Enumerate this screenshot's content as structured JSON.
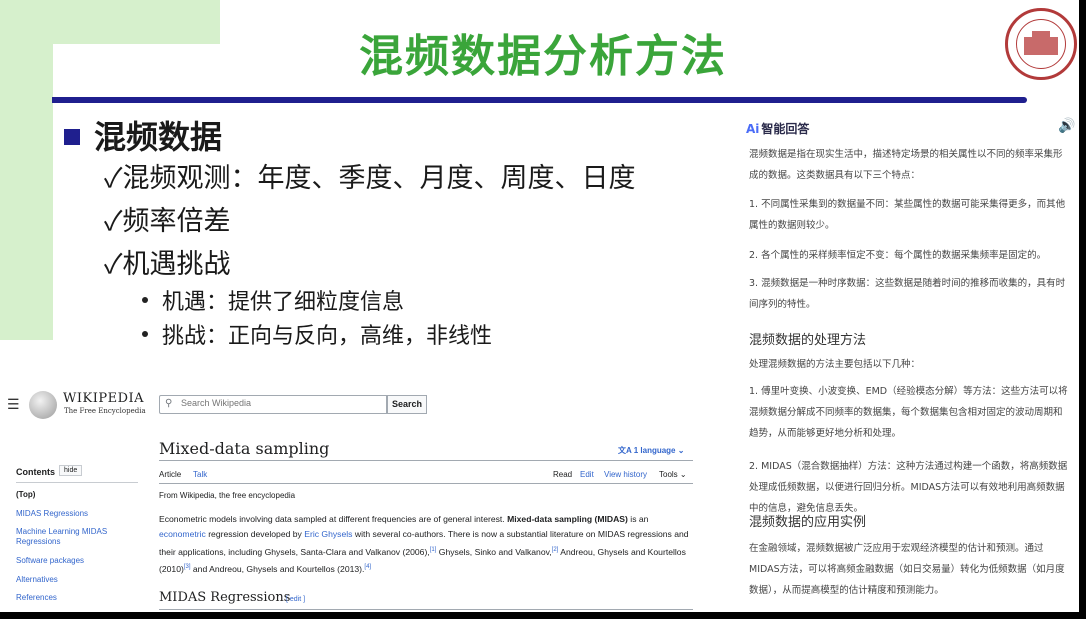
{
  "slide": {
    "title": "混频数据分析方法",
    "heading": "混频数据",
    "items": [
      "✓混频观测：年度、季度、月度、周度、日度",
      "✓频率倍差",
      "✓机遇挑战"
    ],
    "subitems": [
      "机遇：提供了细粒度信息",
      "挑战：正向与反向，高维，非线性"
    ]
  },
  "ai_panel": {
    "logo": "Ai",
    "title": "智能回答",
    "speaker_icon": "🔊",
    "p1": "混频数据是指在现实生活中，描述特定场景的相关属性以不同的频率采集形成的数据。这类数据具有以下三个特点：",
    "p2": "1. 不同属性采集到的数据量不同：某些属性的数据可能采集得更多，而其他属性的数据则较少。",
    "p3": "2. 各个属性的采样频率恒定不变：每个属性的数据采集频率是固定的。",
    "p4": "3. 混频数据是一种时序数据：这些数据是随着时间的推移而收集的，具有时间序列的特性。",
    "h1": "混频数据的处理方法",
    "p5": "处理混频数据的方法主要包括以下几种：",
    "p6": "1. 傅里叶变换、小波变换、EMD（经验模态分解）等方法：这些方法可以将混频数据分解成不同频率的数据集，每个数据集包含相对固定的波动周期和趋势，从而能够更好地分析和处理。",
    "p7": "2. MIDAS（混合数据抽样）方法：这种方法通过构建一个函数，将高频数据处理成低频数据，以便进行回归分析。MIDAS方法可以有效地利用高频数据中的信息，避免信息丢失。",
    "h2": "混频数据的应用实例",
    "p8": "在金融领域，混频数据被广泛应用于宏观经济模型的估计和预测。通过MIDAS方法，可以将高频金融数据（如日交易量）转化为低频数据（如月度数据），从而提高模型的估计精度和预测能力。"
  },
  "wiki": {
    "wordmark": "WIKIPEDIA",
    "tagline": "The Free Encyclopedia",
    "search_placeholder": "Search Wikipedia",
    "search_button": "Search",
    "contents_title": "Contents",
    "hide": "hide",
    "toc": [
      "(Top)",
      "MIDAS Regressions",
      "Machine Learning MIDAS Regressions",
      "Software packages",
      "Alternatives",
      "References"
    ],
    "article_title": "Mixed-data sampling",
    "language": "1 language",
    "tabs_left": [
      "Article",
      "Talk"
    ],
    "tabs_right": [
      "Read",
      "Edit",
      "View history",
      "Tools"
    ],
    "from": "From Wikipedia, the free encyclopedia",
    "para": {
      "t1": "Econometric models involving data sampled at different frequencies are of general interest. ",
      "b1": "Mixed-data sampling (MIDAS)",
      "t2": " is an ",
      "l1": "econometric",
      "t3": " regression developed by ",
      "l2": "Eric Ghysels",
      "t4": " with several co-authors. There is now a substantial literature on MIDAS regressions and their applications, including Ghysels, Santa-Clara and Valkanov (2006),",
      "s1": "[1]",
      "t5": " Ghysels, Sinko and Valkanov,",
      "s2": "[2]",
      "t6": " Andreou, Ghysels and Kourtellos (2010)",
      "s3": "[3]",
      "t7": " and Andreou, Ghysels and Kourtellos (2013).",
      "s4": "[4]"
    },
    "section_title": "MIDAS Regressions",
    "section_edit": "[ edit ]"
  }
}
